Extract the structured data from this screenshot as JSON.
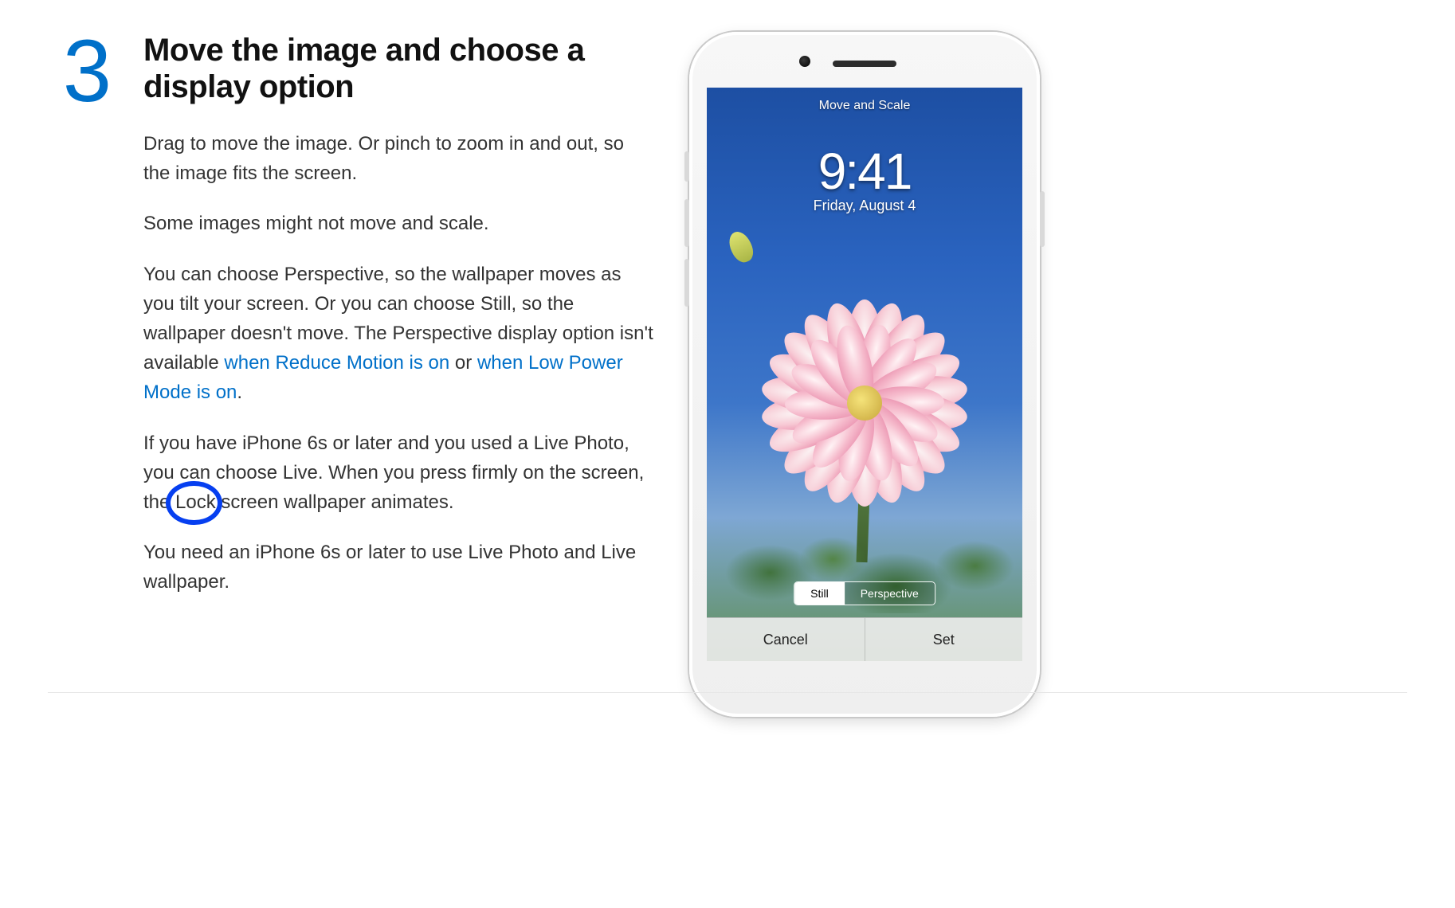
{
  "step": {
    "number": "3"
  },
  "heading": "Move the image and choose a display option",
  "paragraphs": {
    "p1": "Drag to move the image. Or pinch to zoom in and out, so the image fits the screen.",
    "p2": "Some images might not move and scale.",
    "p3_a": "You can choose Perspective, so the wallpaper moves as you tilt your screen. Or you can choose Still, so the wallpaper doesn't move. The Perspective display option isn't available ",
    "p3_link1": "when Reduce Motion is on",
    "p3_b": " or ",
    "p3_link2": "when Low Power Mode is on",
    "p3_c": ".",
    "p4_a": "If you have iPhone 6s or later and you used a Live Photo, you can choose Live. When you press firmly on the screen, the ",
    "p4_circled": "Lock",
    "p4_b": " screen wallpaper animates.",
    "p5": "You need an iPhone 6s or later to use Live Photo and Live wallpaper."
  },
  "phone": {
    "header": "Move and Scale",
    "time": "9:41",
    "date": "Friday, August 4",
    "segment": {
      "still": "Still",
      "perspective": "Perspective"
    },
    "buttons": {
      "cancel": "Cancel",
      "set": "Set"
    }
  }
}
